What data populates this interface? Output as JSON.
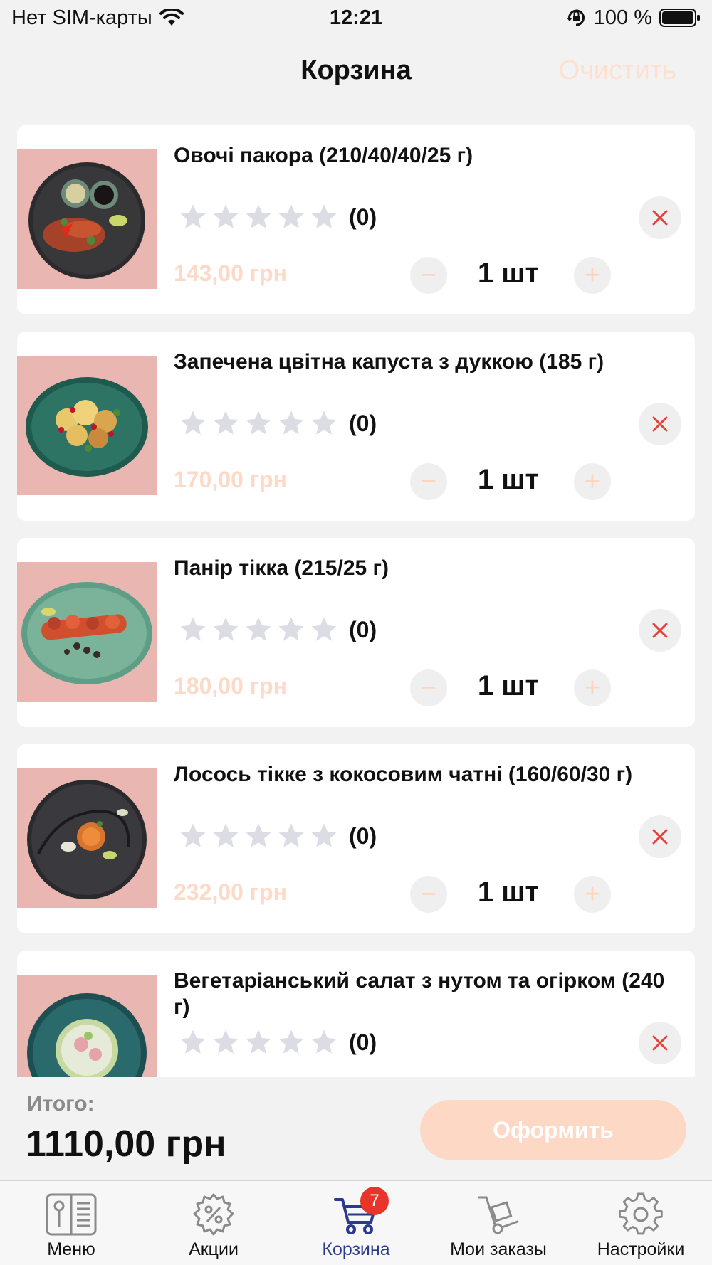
{
  "status_bar": {
    "carrier": "Нет SIM-карты",
    "time": "12:21",
    "battery": "100 %"
  },
  "nav": {
    "title": "Корзина",
    "clear_label": "Очистить"
  },
  "items": [
    {
      "name": "Овочі пакора (210/40/40/25 г)",
      "rating_count": "(0)",
      "price": "143,00 грн",
      "quantity": "1 шт"
    },
    {
      "name": "Запечена цвітна капуста з дуккою (185 г)",
      "rating_count": "(0)",
      "price": "170,00 грн",
      "quantity": "1 шт"
    },
    {
      "name": "Панір тікка (215/25 г)",
      "rating_count": "(0)",
      "price": "180,00 грн",
      "quantity": "1 шт"
    },
    {
      "name": "Лосось тікке з кокосовим чатні (160/60/30 г)",
      "rating_count": "(0)",
      "price": "232,00 грн",
      "quantity": "1 шт"
    },
    {
      "name": "Вегетаріанський салат з нутом та огірком (240 г)",
      "rating_count": "(0)",
      "price": "",
      "quantity": ""
    }
  ],
  "summary": {
    "total_label": "Итого:",
    "total_value": "1110,00 грн",
    "checkout_label": "Оформить"
  },
  "tab_bar": {
    "tabs": [
      {
        "label": "Меню",
        "icon": "menu-book-icon"
      },
      {
        "label": "Акции",
        "icon": "discount-gear-icon"
      },
      {
        "label": "Корзина",
        "icon": "cart-icon",
        "badge": "7"
      },
      {
        "label": "Мои заказы",
        "icon": "hand-truck-icon"
      },
      {
        "label": "Настройки",
        "icon": "settings-gear-icon"
      }
    ]
  },
  "colors": {
    "accent_light": "#fddac8",
    "active_tab": "#2a3a8c",
    "badge": "#e8342a",
    "remove_x": "#e5413a"
  }
}
